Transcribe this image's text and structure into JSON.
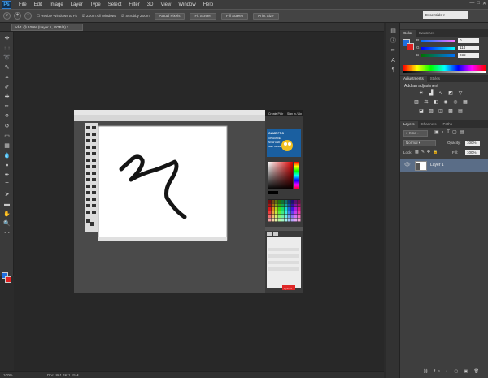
{
  "app": {
    "logo": "Ps"
  },
  "menu": [
    "File",
    "Edit",
    "Image",
    "Layer",
    "Type",
    "Select",
    "Filter",
    "3D",
    "View",
    "Window",
    "Help"
  ],
  "window_controls": [
    "—",
    "□",
    "✕"
  ],
  "options": {
    "resize_windows": "Resize Windows to Fit",
    "zoom_all": "Zoom All Windows",
    "scrubby_zoom": "Scrubby Zoom",
    "actual_pixels": "Actual Pixels",
    "fit_screen": "Fit Screen",
    "fill_screen": "Fill Screen",
    "print_size": "Print Size",
    "workspace": "Essentials"
  },
  "document_tab": "ed-1 @ 100% (Layer 1, RGB/8) *",
  "statusbar": {
    "zoom": "100%",
    "doc": "Doc: 861.4K/1.15M"
  },
  "color_panel": {
    "tabs": [
      "Color",
      "Swatches"
    ],
    "r_label": "R",
    "g_label": "G",
    "b_label": "B",
    "r_value": "0",
    "g_value": "114",
    "b_value": "255"
  },
  "adjustments_panel": {
    "tabs": [
      "Adjustments",
      "Styles"
    ],
    "heading": "Add an adjustment"
  },
  "layers_panel": {
    "tabs": [
      "Layers",
      "Channels",
      "Paths"
    ],
    "kind": "Kind",
    "blend_mode": "Normal",
    "opacity_label": "Opacity:",
    "opacity_value": "100%",
    "lock_label": "Lock:",
    "fill_label": "Fill:",
    "fill_value": "100%",
    "layer_name": "Layer 1"
  },
  "embedded_screenshot": {
    "bg_header": "Create Pixlr",
    "sign_in": "Sign in / Up",
    "ad_title": "GAME PRO",
    "ad_line1": "UPGRADE",
    "ad_line2": "NOW AND",
    "ad_line3": "GET MORE",
    "remove_button": "Upload"
  }
}
